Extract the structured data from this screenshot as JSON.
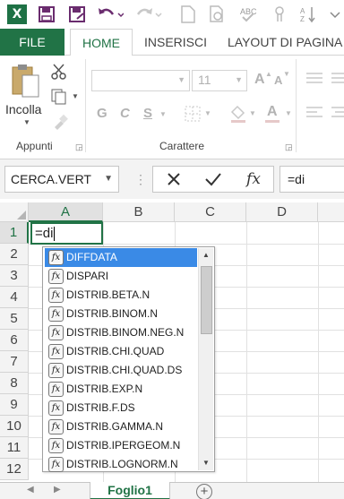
{
  "app": {
    "brand_color": "#217346",
    "logo_letter": "X",
    "quick_access": [
      {
        "icon": "save-icon"
      },
      {
        "icon": "save-as-icon"
      },
      {
        "icon": "undo-icon"
      },
      {
        "icon": "redo-icon"
      },
      {
        "icon": "new-document-icon"
      },
      {
        "icon": "print-preview-icon"
      },
      {
        "icon": "spelling-check-icon"
      },
      {
        "icon": "sort-icon"
      }
    ]
  },
  "tabs": {
    "file": "FILE",
    "home": "HOME",
    "insert": "INSERISCI",
    "layout": "LAYOUT DI PAGINA"
  },
  "ribbon": {
    "clipboard": {
      "paste_label": "Incolla",
      "group_label": "Appunti"
    },
    "font": {
      "font_size": "11",
      "grow": "A",
      "shrink": "A",
      "bold": "G",
      "italic": "C",
      "underline": "S",
      "font_color_letter": "A",
      "group_label": "Carattere"
    }
  },
  "formula_bar": {
    "name_box": "CERCA.VERT",
    "fx_label": "fx",
    "content": "=di"
  },
  "sheet": {
    "columns": [
      "A",
      "B",
      "C",
      "D"
    ],
    "rows": [
      "1",
      "2",
      "3",
      "4",
      "5",
      "6",
      "7",
      "8",
      "9",
      "10",
      "11",
      "12"
    ],
    "active_cell_content": "=di"
  },
  "autocomplete": {
    "items": [
      "DIFFDATA",
      "DISPARI",
      "DISTRIB.BETA.N",
      "DISTRIB.BINOM.N",
      "DISTRIB.BINOM.NEG.N",
      "DISTRIB.CHI.QUAD",
      "DISTRIB.CHI.QUAD.DS",
      "DISTRIB.EXP.N",
      "DISTRIB.F.DS",
      "DISTRIB.GAMMA.N",
      "DISTRIB.IPERGEOM.N",
      "DISTRIB.LOGNORM.N"
    ],
    "selected_index": 0,
    "fx_glyph": "fx"
  },
  "sheet_tabs": {
    "active": "Foglio1",
    "add_glyph": "+"
  }
}
